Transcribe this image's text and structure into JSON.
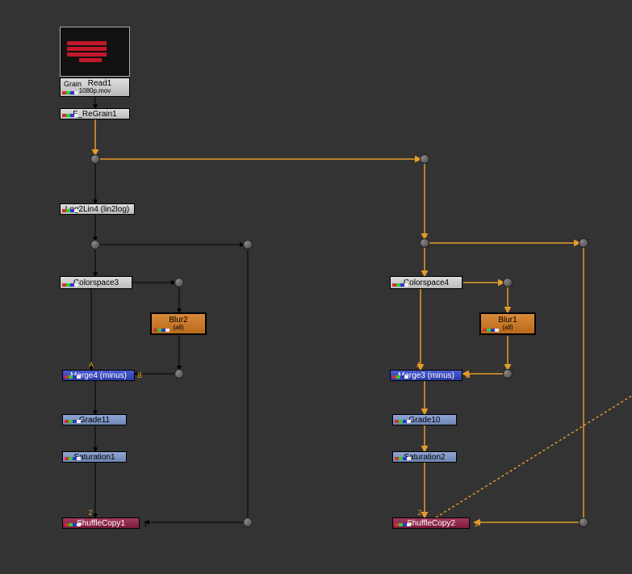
{
  "nodes": {
    "read1": {
      "label": "Read1",
      "sub": "1080p.mov",
      "type": "read"
    },
    "grain": {
      "label": "Grain"
    },
    "regrain": {
      "label": "F_ReGrain1"
    },
    "log2lin": {
      "label": "Log2Lin4 (lin2log)"
    },
    "colorspace3": {
      "label": "Colorspace3"
    },
    "blur2": {
      "label": "Blur2",
      "sub": "(all)"
    },
    "merge4": {
      "label": "Merge4 (minus)"
    },
    "grade11": {
      "label": "Grade11"
    },
    "saturation1": {
      "label": "Saturation1"
    },
    "shufflecopy1": {
      "label": "ShuffleCopy1"
    },
    "colorspace4": {
      "label": "Colorspace4"
    },
    "blur1": {
      "label": "Blur1",
      "sub": "(all)"
    },
    "merge3": {
      "label": "Merge3 (minus)"
    },
    "grade10": {
      "label": "Grade10"
    },
    "saturation2": {
      "label": "Saturation2"
    },
    "shufflecopy2": {
      "label": "ShuffleCopy2"
    }
  },
  "ports": {
    "merge4": {
      "a": "A",
      "b": "B"
    },
    "merge3": {
      "a": "A",
      "b": "B"
    },
    "shufflecopy1": {
      "one": "1",
      "two": "2"
    },
    "shufflecopy2": {
      "one": "1",
      "two": "2"
    }
  }
}
